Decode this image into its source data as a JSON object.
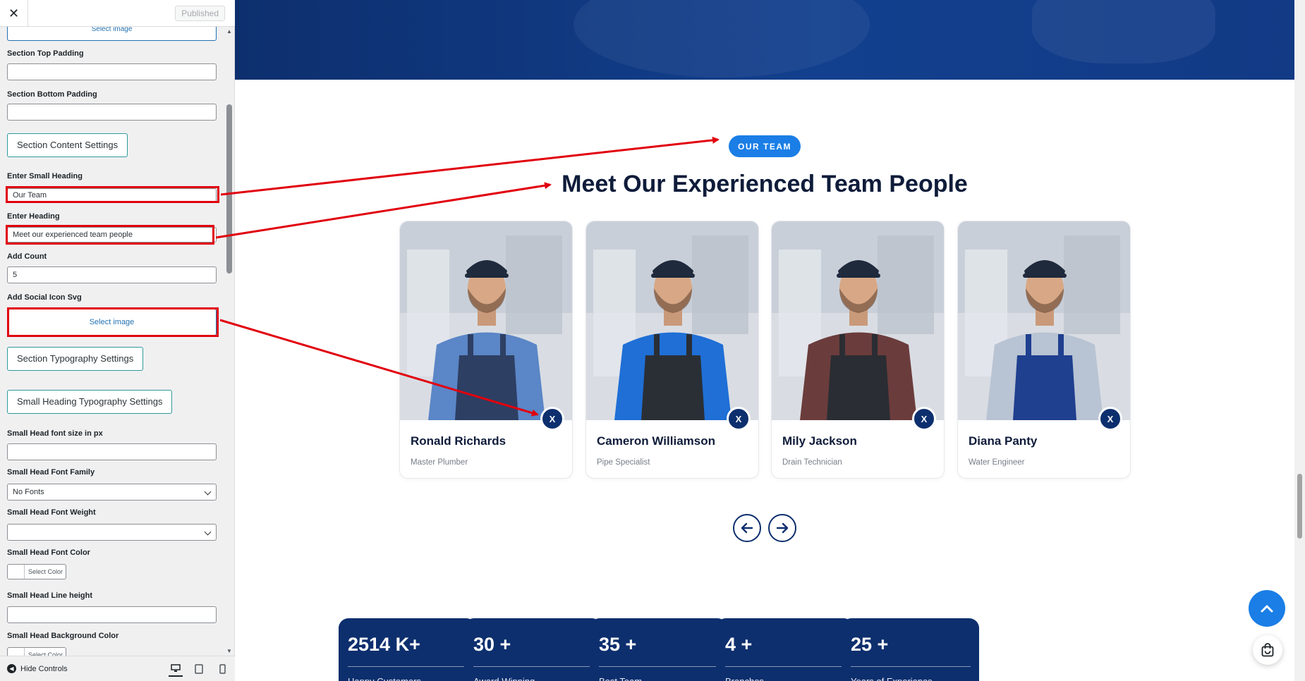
{
  "sidebar": {
    "close_icon": "close-icon",
    "published_label": "Published",
    "fields": {
      "select_image_top": "Select image",
      "top_padding_label": "Section Top Padding",
      "bottom_padding_label": "Section Bottom Padding",
      "content_settings_button": "Section Content Settings",
      "small_heading_label": "Enter Small Heading",
      "small_heading_value": "Our Team",
      "heading_label": "Enter Heading",
      "heading_value": "Meet our experienced team people",
      "count_label": "Add Count",
      "count_value": "5",
      "social_icon_label": "Add Social Icon Svg",
      "social_icon_button": "Select image",
      "typography_button": "Section Typography Settings",
      "small_heading_typography_button": "Small Heading Typography Settings",
      "font_size_label": "Small Head font size in px",
      "font_family_label": "Small Head Font Family",
      "font_family_value": "No Fonts",
      "font_weight_label": "Small Head Font Weight",
      "font_weight_value": "",
      "font_color_label": "Small Head Font Color",
      "select_color": "Select Color",
      "line_height_label": "Small Head Line height",
      "bg_color_label": "Small Head Background Color"
    },
    "footer": {
      "hide_controls": "Hide Controls"
    }
  },
  "preview": {
    "badge": "OUR TEAM",
    "heading": "Meet Our Experienced Team People",
    "team": [
      {
        "name": "Ronald Richards",
        "role": "Master Plumber",
        "shirt": "#5b86c7",
        "overall": "#2d3f63"
      },
      {
        "name": "Cameron Williamson",
        "role": "Pipe Specialist",
        "shirt": "#1f6fd6",
        "overall": "#2a2f36"
      },
      {
        "name": "Mily Jackson",
        "role": "Drain Technician",
        "shirt": "#6b3c3c",
        "overall": "#2a2d33"
      },
      {
        "name": "Diana Panty",
        "role": "Water Engineer",
        "shirt": "#b8c3d3",
        "overall": "#1f3f8f"
      }
    ],
    "social_label": "X",
    "stats": [
      {
        "value": "2514 K+",
        "label": "Happy Customers"
      },
      {
        "value": "30 +",
        "label": "Award Winning"
      },
      {
        "value": "35 +",
        "label": "Best Team"
      },
      {
        "value": "4 +",
        "label": "Branches"
      },
      {
        "value": "25 +",
        "label": "Years of Experience"
      }
    ]
  },
  "colors": {
    "accent_blue": "#1a7ee6",
    "navy": "#0d2f6e",
    "highlight_red": "#e1000e"
  }
}
